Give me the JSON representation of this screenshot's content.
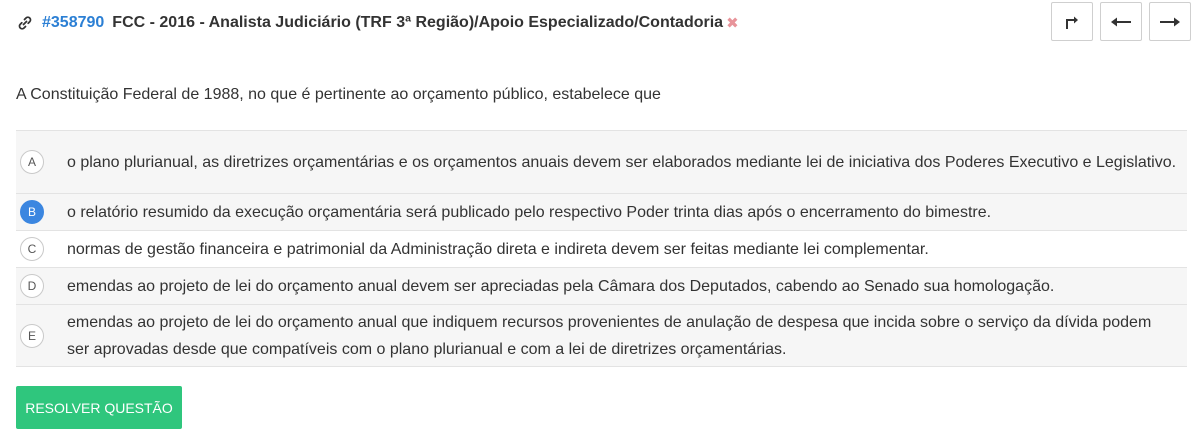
{
  "header": {
    "question_id": "#358790",
    "title": "FCC - 2016 - Analista Judiciário (TRF 3ª Região)/Apoio Especializado/Contadoria",
    "remove_symbol": "✖",
    "icons": {
      "link": "link-icon",
      "share": "share-arrow-icon",
      "previous": "arrow-left-icon",
      "next": "arrow-right-icon"
    }
  },
  "question": {
    "statement": "A Constituição Federal de 1988, no que é pertinente ao orçamento público, estabelece que",
    "options": [
      {
        "letter": "A",
        "text": "o plano plurianual, as diretrizes orçamentárias e os orçamentos anuais devem ser elaborados mediante lei de iniciativa dos Poderes Executivo e Legislativo.",
        "selected": false
      },
      {
        "letter": "B",
        "text": "o relatório resumido da execução orçamentária será publicado pelo respectivo Poder trinta dias após o encerramento do bimestre.",
        "selected": true
      },
      {
        "letter": "C",
        "text": "normas de gestão financeira e patrimonial da Administração direta e indireta devem ser feitas mediante lei complementar.",
        "selected": false
      },
      {
        "letter": "D",
        "text": "emendas ao projeto de lei do orçamento anual devem ser apreciadas pela Câmara dos Deputados, cabendo ao Senado sua homologação.",
        "selected": false
      },
      {
        "letter": "E",
        "text": "emendas ao projeto de lei do orçamento anual que indiquem recursos provenientes de anulação de despesa que incida sobre o serviço da dívida podem ser aprovadas desde que compatíveis com o plano plurianual e com a lei de diretrizes orçamentárias.",
        "selected": false
      }
    ]
  },
  "actions": {
    "resolve_label": "RESOLVER QUESTÃO"
  },
  "colors": {
    "link_blue": "#2b7fd4",
    "selected_blue": "#3b86e0",
    "resolve_green": "#2fc67d",
    "remove_pink": "#e8949a"
  }
}
